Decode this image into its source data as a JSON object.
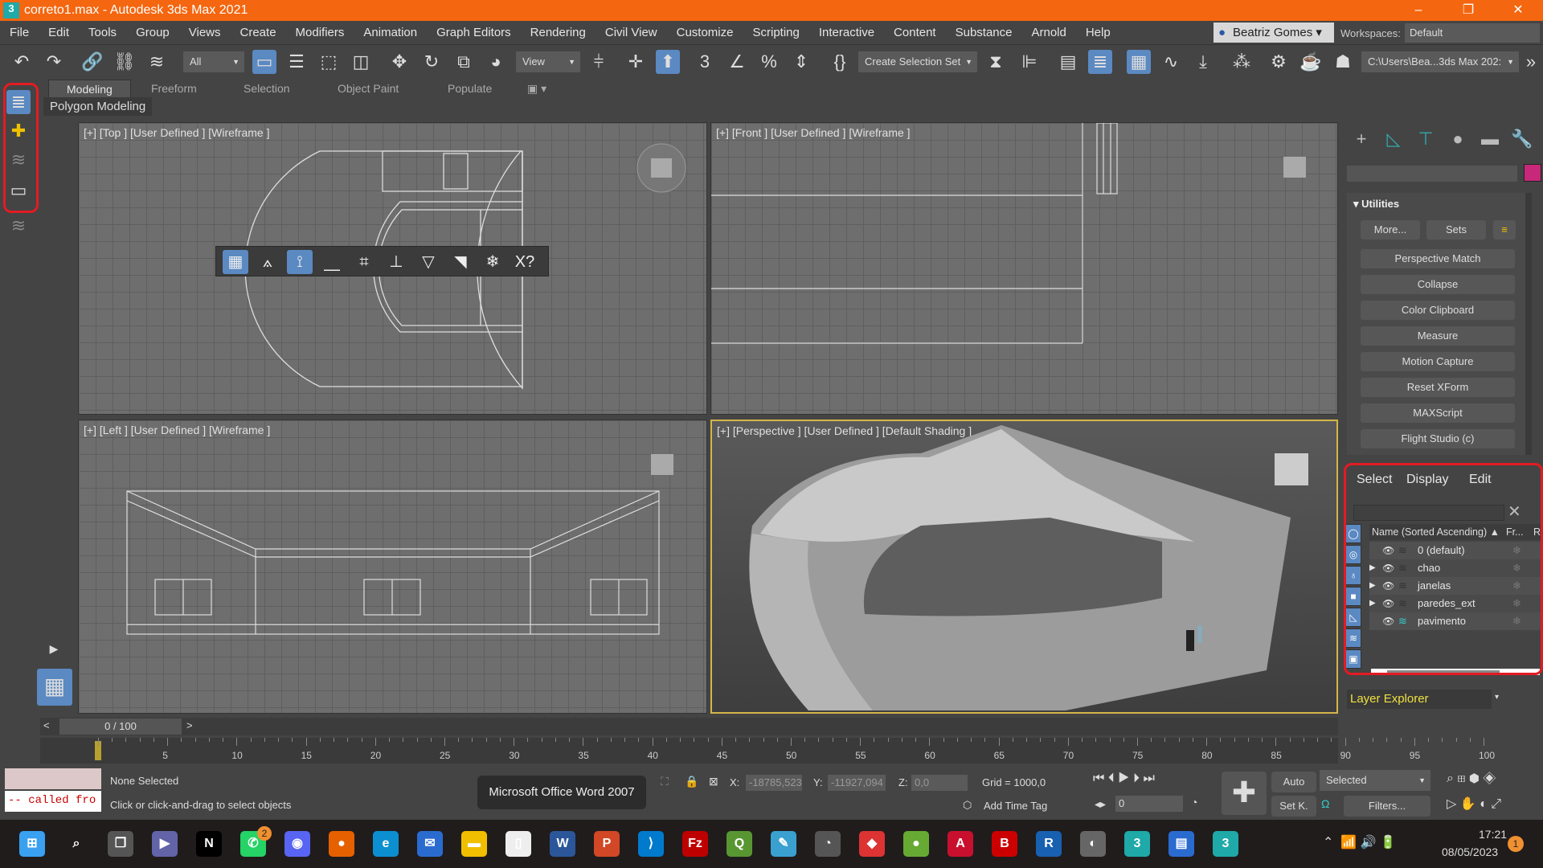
{
  "window": {
    "title": "correto1.max - Autodesk 3ds Max 2021",
    "logo": "3",
    "minimize": "–",
    "restore": "❐",
    "close": "✕"
  },
  "colors": {
    "titlebar": "#f4660f",
    "accent": "#5b89c2",
    "highlight": "#e31b23",
    "layer_explorer_text": "#f0e040"
  },
  "menu": [
    "File",
    "Edit",
    "Tools",
    "Group",
    "Views",
    "Create",
    "Modifiers",
    "Animation",
    "Graph Editors",
    "Rendering",
    "Civil View",
    "Customize",
    "Scripting",
    "Interactive",
    "Content",
    "Substance",
    "Arnold",
    "Help"
  ],
  "user": {
    "name": "Beatriz Gomes"
  },
  "workspace": {
    "label": "Workspaces:",
    "value": "Default"
  },
  "toolbar": {
    "filter": "All",
    "ref_coord": "View",
    "selection_set": "Create Selection Set",
    "project_path": "C:\\Users\\Bea...3ds Max 202:"
  },
  "ribbon": {
    "tabs": [
      "Modeling",
      "Freeform",
      "Selection",
      "Object Paint",
      "Populate"
    ],
    "active": "Modeling",
    "panel": "Polygon Modeling"
  },
  "viewports": {
    "top": "[+] [Top ] [User Defined ] [Wireframe ]",
    "front": "[+] [Front ] [User Defined ] [Wireframe ]",
    "left": "[+] [Left ] [User Defined ] [Wireframe ]",
    "perspective": "[+] [Perspective ] [User Defined ] [Default Shading ]"
  },
  "snap_toolbar": {
    "last": "X?"
  },
  "command_panel": {
    "rollout": "Utilities",
    "more": "More...",
    "sets": "Sets",
    "buttons": [
      "Perspective Match",
      "Collapse",
      "Color Clipboard",
      "Measure",
      "Motion Capture",
      "Reset XForm",
      "MAXScript",
      "Flight Studio (c)"
    ],
    "object_color": "#c8287a"
  },
  "layer_explorer": {
    "menu": [
      "Select",
      "Display",
      "Edit"
    ],
    "columns": {
      "name": "Name (Sorted Ascending)",
      "frozen": "Fr...",
      "render": "R."
    },
    "layers": [
      {
        "name": "0 (default)",
        "expandable": false,
        "active": false
      },
      {
        "name": "chao",
        "expandable": true,
        "active": false
      },
      {
        "name": "janelas",
        "expandable": true,
        "active": false
      },
      {
        "name": "paredes_ext",
        "expandable": true,
        "active": false
      },
      {
        "name": "pavimento",
        "expandable": false,
        "active": true
      }
    ],
    "title": "Layer Explorer"
  },
  "timeline": {
    "frame": "0 / 100",
    "prev": "<",
    "next": ">",
    "ticks": [
      "5",
      "10",
      "15",
      "20",
      "25",
      "30",
      "35",
      "40",
      "45",
      "50",
      "55",
      "60",
      "65",
      "70",
      "75",
      "80",
      "85",
      "90",
      "95",
      "100"
    ]
  },
  "status": {
    "script_output": "-- called fro",
    "selection": "None Selected",
    "prompt": "Click or click-and-drag to select objects",
    "tooltip": "Microsoft Office Word 2007",
    "x_label": "X:",
    "x": "-18785,523",
    "y_label": "Y:",
    "y": "-11927,094",
    "z_label": "Z:",
    "z": "0,0",
    "grid": "Grid = 1000,0",
    "time_tag": "Add Time Tag",
    "auto": "Auto",
    "set_key": "Set K.",
    "key_filter": "Selected",
    "filters": "Filters...",
    "frame": "0"
  },
  "taskbar": {
    "whatsapp_badge": "2",
    "time": "17:21",
    "date": "08/05/2023",
    "notifications": "1"
  }
}
